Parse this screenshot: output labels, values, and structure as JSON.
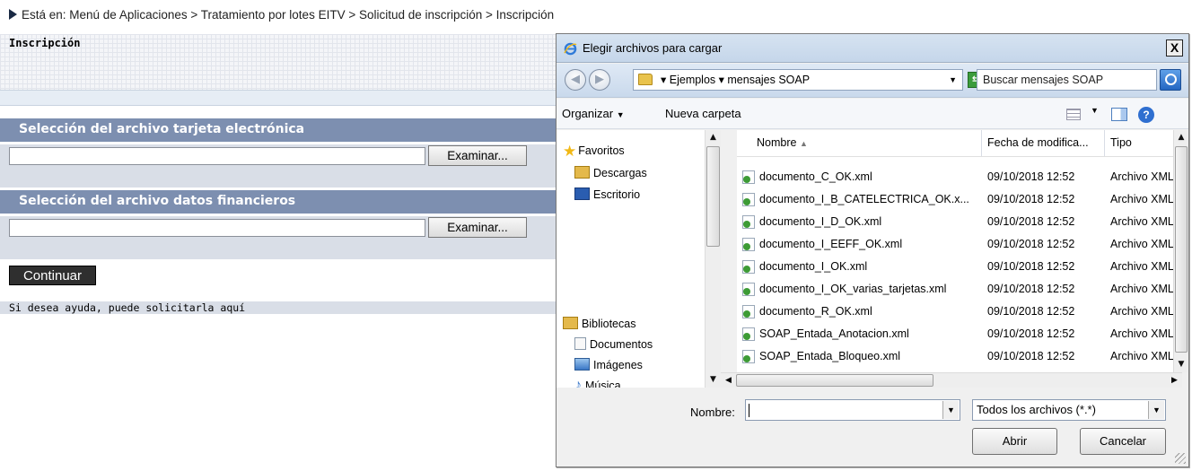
{
  "breadcrumb": {
    "text": "Está en: Menú de Aplicaciones > Tratamiento por lotes EITV > Solicitud de inscripción > Inscripción"
  },
  "form": {
    "title": "Inscripción",
    "section1_title": "Selección del archivo tarjeta electrónica",
    "section2_title": "Selección del archivo datos financieros",
    "browse_label": "Examinar...",
    "continue_label": "Continuar",
    "help_text": "Si desea ayuda, puede solicitarla aquí"
  },
  "dialog": {
    "title": "Elegir archivos para cargar",
    "close_label": "X",
    "address": "▾ Ejemplos ▾ mensajes SOAP",
    "search_placeholder": "Buscar mensajes SOAP",
    "toolbar": {
      "organize": "Organizar",
      "new_folder": "Nueva carpeta"
    },
    "nav": {
      "favorites": "Favoritos",
      "downloads": "Descargas",
      "desktop": "Escritorio",
      "libraries": "Bibliotecas",
      "documents": "Documentos",
      "images": "Imágenes",
      "music": "Música"
    },
    "columns": {
      "name": "Nombre",
      "date": "Fecha de modifica...",
      "type": "Tipo"
    },
    "files": [
      {
        "name": "documento_C_OK.xml",
        "date": "09/10/2018 12:52",
        "type": "Archivo XML"
      },
      {
        "name": "documento_I_B_CATELECTRICA_OK.x...",
        "date": "09/10/2018 12:52",
        "type": "Archivo XML"
      },
      {
        "name": "documento_I_D_OK.xml",
        "date": "09/10/2018 12:52",
        "type": "Archivo XML"
      },
      {
        "name": "documento_I_EEFF_OK.xml",
        "date": "09/10/2018 12:52",
        "type": "Archivo XML"
      },
      {
        "name": "documento_I_OK.xml",
        "date": "09/10/2018 12:52",
        "type": "Archivo XML"
      },
      {
        "name": "documento_I_OK_varias_tarjetas.xml",
        "date": "09/10/2018 12:52",
        "type": "Archivo XML"
      },
      {
        "name": "documento_R_OK.xml",
        "date": "09/10/2018 12:52",
        "type": "Archivo XML"
      },
      {
        "name": "SOAP_Entada_Anotacion.xml",
        "date": "09/10/2018 12:52",
        "type": "Archivo XML"
      },
      {
        "name": "SOAP_Entada_Bloqueo.xml",
        "date": "09/10/2018 12:52",
        "type": "Archivo XML"
      }
    ],
    "filename_label": "Nombre:",
    "filename_value": "",
    "filetype_value": "Todos los archivos (*.*)",
    "open_label": "Abrir",
    "cancel_label": "Cancelar"
  }
}
